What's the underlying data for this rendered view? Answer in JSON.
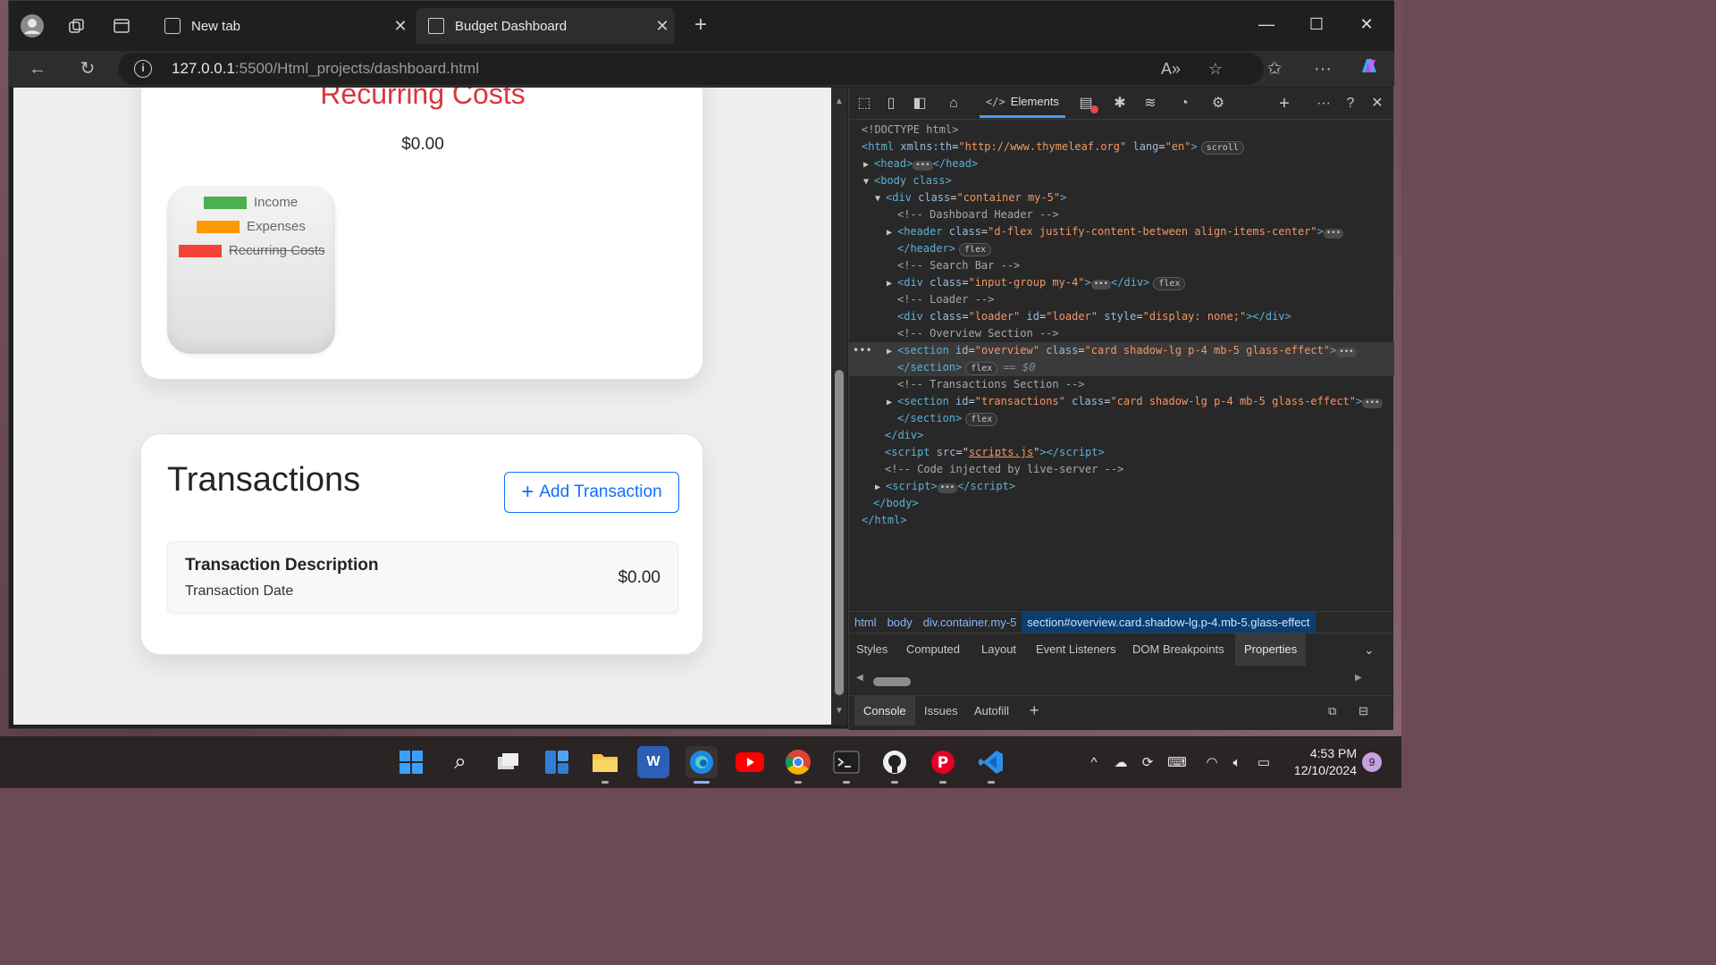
{
  "browser": {
    "tabs": [
      {
        "label": "New tab",
        "active": false
      },
      {
        "label": "Budget Dashboard",
        "active": true
      }
    ],
    "url_host": "127.0.0.1",
    "url_path": ":5500/Html_projects/dashboard.html"
  },
  "page": {
    "overview": {
      "recurring_title": "Recurring Costs",
      "recurring_value": "$0.00",
      "legend": [
        {
          "label": "Income",
          "color": "#4caf50",
          "struck": false
        },
        {
          "label": "Expenses",
          "color": "#ff9800",
          "struck": false
        },
        {
          "label": "Recurring Costs",
          "color": "#f44336",
          "struck": true
        }
      ]
    },
    "transactions": {
      "heading": "Transactions",
      "add_button": "Add Transaction",
      "items": [
        {
          "description": "Transaction Description",
          "date": "Transaction Date",
          "amount": "$0.00"
        }
      ]
    }
  },
  "devtools": {
    "active_tab": "Elements",
    "dom": {
      "doctype": "<!DOCTYPE html>",
      "html_open_attrs": [
        "xmlns:th",
        "\"http://www.thymeleaf.org\"",
        "lang",
        "\"en\""
      ],
      "scroll_pill": "scroll",
      "head": "head",
      "body_open": "body class",
      "div_container": "\"container my-5\"",
      "c_header": "<!-- Dashboard Header -->",
      "header_class": "\"d-flex justify-content-between align-items-center\"",
      "flex_pill": "flex",
      "c_search": "<!-- Search Bar -->",
      "search_class": "\"input-group my-4\"",
      "c_loader": "<!-- Loader -->",
      "loader_class": "\"loader\"",
      "loader_id": "\"loader\"",
      "loader_style": "\"display: none;\"",
      "c_overview": "<!-- Overview Section -->",
      "overview_id": "\"overview\"",
      "section_class": "\"card shadow-lg p-4 mb-5 glass-effect\"",
      "eq0": "== $0",
      "c_transactions": "<!-- Transactions Section -->",
      "transactions_id": "\"transactions\"",
      "script_src": "scripts.js",
      "c_injected": "<!-- Code injected by live-server -->"
    },
    "breadcrumbs": [
      "html",
      "body",
      "div.container.my-5",
      "section#overview.card.shadow-lg.p-4.mb-5.glass-effect"
    ],
    "subtabs": [
      "Styles",
      "Computed",
      "Layout",
      "Event Listeners",
      "DOM Breakpoints",
      "Properties"
    ],
    "active_subtab": "Properties",
    "drawer_tabs": [
      "Console",
      "Issues",
      "Autofill"
    ],
    "active_drawer_tab": "Console"
  },
  "taskbar": {
    "time": "4:53 PM",
    "date": "12/10/2024",
    "notifications": "9"
  }
}
